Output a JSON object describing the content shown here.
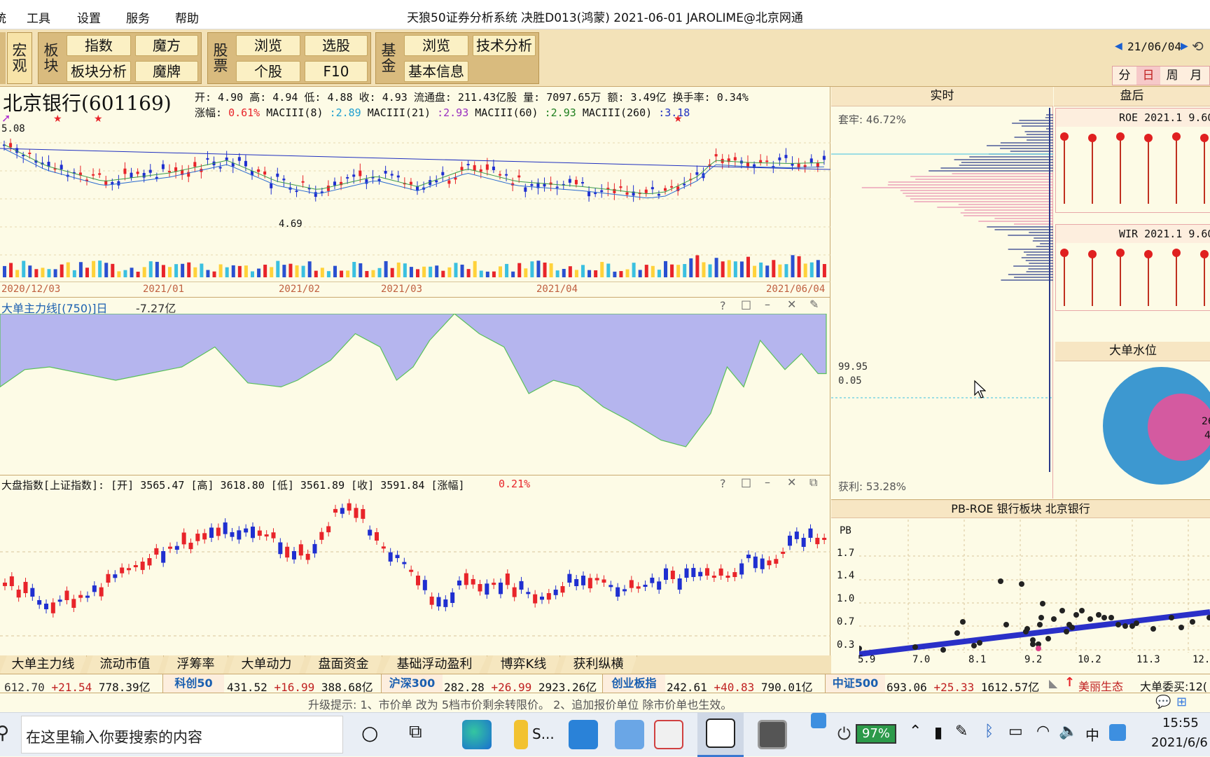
{
  "window": {
    "menu": [
      "工具",
      "设置",
      "服务",
      "帮助"
    ],
    "menu_first_partial": "统",
    "title": "天狼50证券分析系统  决胜D013(鸿蒙)  2021-06-01 JAROLIME@北京网通"
  },
  "toolbar": {
    "macro": "宏观",
    "sector": "板块",
    "btn_index": "指数",
    "btn_cube": "魔方",
    "btn_sector_analysis": "板块分析",
    "btn_magic_card": "魔牌",
    "stock_label": "股票",
    "btn_browse": "浏览",
    "btn_pick": "选股",
    "btn_single": "个股",
    "btn_f10": "F10",
    "fund_label": "基金",
    "btn_fund_browse": "浏览",
    "btn_tech": "技术分析",
    "btn_basic": "基本信息",
    "date_nav": "21/06/04",
    "periods": [
      "分",
      "日",
      "周",
      "月"
    ]
  },
  "stock": {
    "name": "北京银行(601169)",
    "quote_line1": "开: 4.90  高: 4.94  低: 4.88  收: 4.93  流通盘: 211.43亿股  量: 7097.65万  额: 3.49亿  换手率: 0.34%",
    "change_label": "涨幅:",
    "change_value": "0.61%",
    "ma1_label": "MACIII(8)",
    "ma1_value": ":2.89",
    "ma2_label": "MACIII(21)",
    "ma2_value": ":2.93",
    "ma3_label": "MACIII(60)",
    "ma3_value": ":2.93",
    "ma4_label": "MACIII(260)",
    "ma4_value": ":3.18",
    "high_marker": "5.08",
    "low_marker": "4.69",
    "dates": [
      "2020/12/03",
      "2021/01",
      "2021/02",
      "2021/03",
      "2021/04",
      "2021/06/04"
    ]
  },
  "flow_panel": {
    "title": "大单主力线[(750)]日",
    "value": "-7.27亿",
    "icons": [
      "help-icon",
      "maximize-icon",
      "minimize-icon",
      "close-icon",
      "wrench-icon"
    ]
  },
  "index_panel": {
    "title": "大盘指数[上证指数]: [开] 3565.47 [高] 3618.80 [低] 3561.89 [收] 3591.84 [涨幅]",
    "change": "0.21%"
  },
  "realtime": {
    "header": "实时",
    "trapped": "套牢: 46.72%",
    "level_hi": "99.95",
    "level_lo": "0.05",
    "profit": "获利: 53.28%"
  },
  "after_hours": {
    "header": "盘后",
    "roe_label": "ROE 2021.1 9.60",
    "wir_label": "WIR 2021.1 9.60",
    "big_order": "大单水位",
    "pie_text1": "26",
    "pie_text2": "4"
  },
  "scatter": {
    "header": "PB-ROE  银行板块  北京银行",
    "ylabel": "PB",
    "yticks": [
      "1.7",
      "1.4",
      "1.0",
      "0.7",
      "0.3"
    ],
    "xticks": [
      "5.9",
      "7.0",
      "8.1",
      "9.2",
      "10.2",
      "11.3",
      "12."
    ]
  },
  "bottom_tabs": [
    "大单主力线",
    "流动市值",
    "浮筹率",
    "大单动力",
    "盘面资金",
    "基础浮动盈利",
    "博弈K线",
    "获利纵横"
  ],
  "index_bar": [
    {
      "name": "",
      "price": "612.70",
      "chg": "+21.54",
      "amt": "778.39亿"
    },
    {
      "name": "科创50",
      "price": "431.52",
      "chg": "+16.99",
      "amt": "388.68亿"
    },
    {
      "name": "沪深300",
      "price": "282.28",
      "chg": "+26.99",
      "amt": "2923.26亿"
    },
    {
      "name": "创业板指",
      "price": "242.61",
      "chg": "+40.83",
      "amt": "790.01亿"
    },
    {
      "name": "中证500",
      "price": "693.06",
      "chg": "+25.33",
      "amt": "1612.57亿"
    }
  ],
  "index_bar_extra": {
    "ecology": "美丽生态",
    "big_order": "大单委买:12("
  },
  "status": "升级提示: 1、市价单 改为 5档市价剩余转限价。  2、追加报价单位 除市价单也生效。",
  "taskbar": {
    "search_placeholder": "在这里输入你要搜索的内容",
    "battery": "97%",
    "time": "15:55",
    "date": "2021/6/6",
    "ime": "中",
    "app_label": "S..."
  },
  "colors": {
    "up": "#e8242a",
    "down": "#1f2fd0",
    "accent_pink": "#e0408a",
    "flow_fill": "#b5b5ee"
  }
}
